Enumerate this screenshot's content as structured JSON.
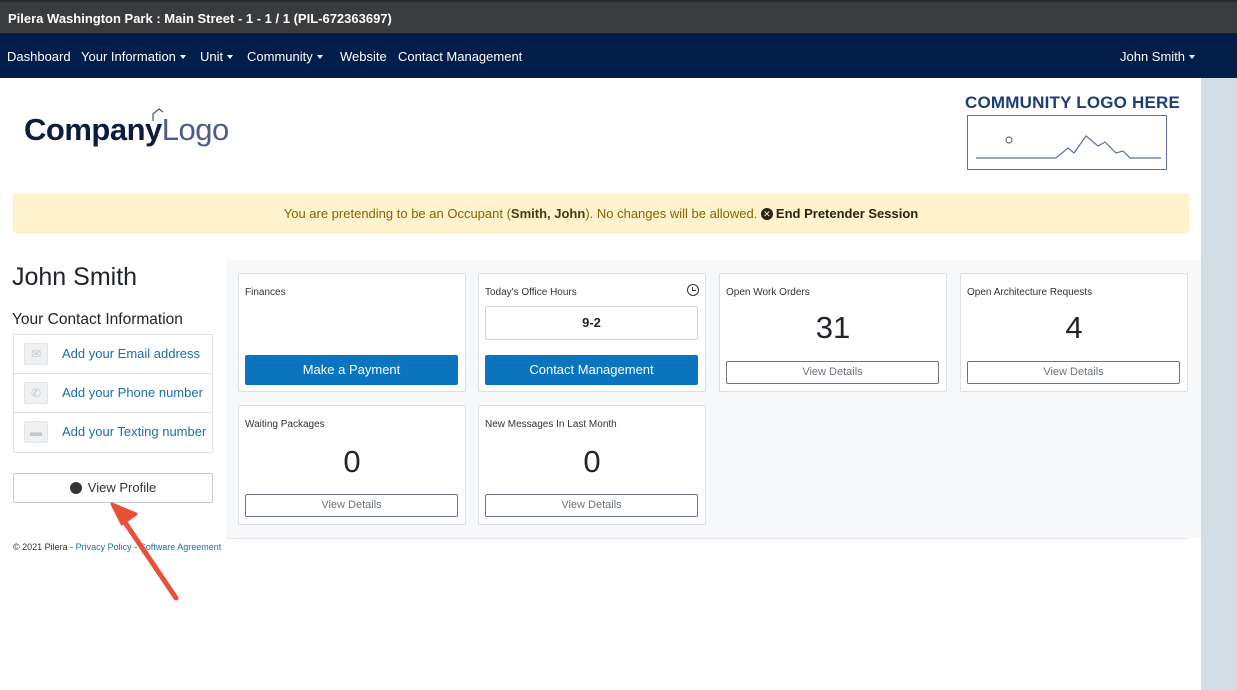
{
  "window": {
    "title": "Pilera Washington Park : Main Street - 1 - 1 / 1 (PIL-672363697)"
  },
  "nav": {
    "items": [
      {
        "label": "Dashboard",
        "dropdown": false
      },
      {
        "label": "Your Information",
        "dropdown": true
      },
      {
        "label": "Unit",
        "dropdown": true
      },
      {
        "label": "Community",
        "dropdown": true
      },
      {
        "label": "Website",
        "dropdown": false
      },
      {
        "label": "Contact Management",
        "dropdown": false
      }
    ],
    "user": "John Smith"
  },
  "logos": {
    "company_bold": "Company",
    "company_light": "Logo",
    "community": "COMMUNITY LOGO HERE"
  },
  "alert": {
    "prefix": "You are pretending to be an Occupant (",
    "name": "Smith, John",
    "suffix": "). No changes will be allowed.",
    "end_label": "End Pretender Session"
  },
  "profile": {
    "name": "John Smith",
    "contact_title": "Your Contact Information",
    "contacts": [
      {
        "icon": "email-icon",
        "label": "Add your Email address"
      },
      {
        "icon": "phone-icon",
        "label": "Add your Phone number"
      },
      {
        "icon": "message-icon",
        "label": "Add your Texting number"
      }
    ],
    "view_profile": "View Profile"
  },
  "cards": {
    "finances": {
      "title": "Finances",
      "button": "Make a Payment"
    },
    "office_hours": {
      "title": "Today's Office Hours",
      "hours": "9-2",
      "button": "Contact Management"
    },
    "work_orders": {
      "title": "Open Work Orders",
      "count": "31",
      "button": "View Details"
    },
    "architecture": {
      "title": "Open Architecture Requests",
      "count": "4",
      "button": "View Details"
    },
    "packages": {
      "title": "Waiting Packages",
      "count": "0",
      "button": "View Details"
    },
    "messages": {
      "title": "New Messages In Last Month",
      "count": "0",
      "button": "View Details"
    }
  },
  "footer": {
    "copyright": "© 2021 Pilera - ",
    "privacy": "Privacy Policy",
    "sep": " - ",
    "agreement": "Software Agreement"
  },
  "colors": {
    "navbar": "#011d4a",
    "primary_button": "#0875be",
    "alert_bg": "#fff3cd",
    "annotation_arrow": "#e8503a"
  }
}
